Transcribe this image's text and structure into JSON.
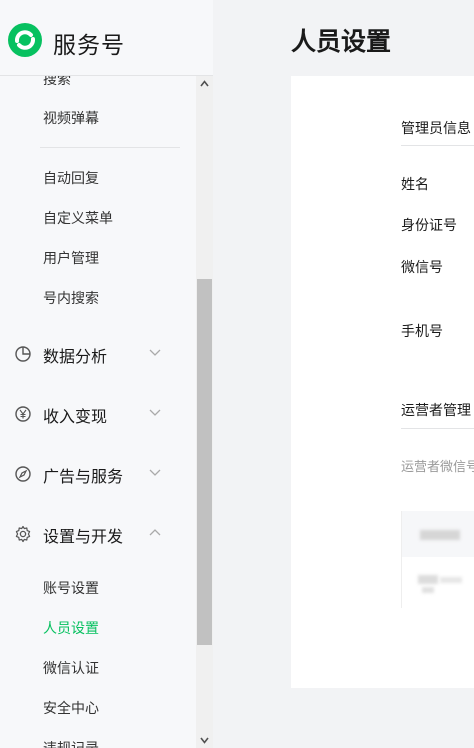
{
  "brand": {
    "name": "服务号"
  },
  "sidebar": {
    "items_top": [
      "搜索",
      "视频弹幕"
    ],
    "items_mid": [
      "自动回复",
      "自定义菜单",
      "用户管理",
      "号内搜索"
    ],
    "groups": [
      {
        "label": "数据分析",
        "icon": "pie-chart-icon",
        "expanded": false
      },
      {
        "label": "收入变现",
        "icon": "yen-circle-icon",
        "expanded": false
      },
      {
        "label": "广告与服务",
        "icon": "compass-icon",
        "expanded": false
      },
      {
        "label": "设置与开发",
        "icon": "gear-icon",
        "expanded": true
      }
    ],
    "settings_items": [
      "账号设置",
      "人员设置",
      "微信认证",
      "安全中心",
      "违规记录"
    ],
    "active_item": "人员设置"
  },
  "main": {
    "title": "人员设置",
    "admin_section": {
      "title": "管理员信息",
      "fields": [
        "姓名",
        "身份证号",
        "微信号",
        "手机号"
      ]
    },
    "operator_section": {
      "title": "运营者管理",
      "description": "运营者微信号"
    }
  },
  "colors": {
    "accent": "#07c160",
    "background": "#f2f3f5",
    "sidebar": "#f7f8fa"
  }
}
